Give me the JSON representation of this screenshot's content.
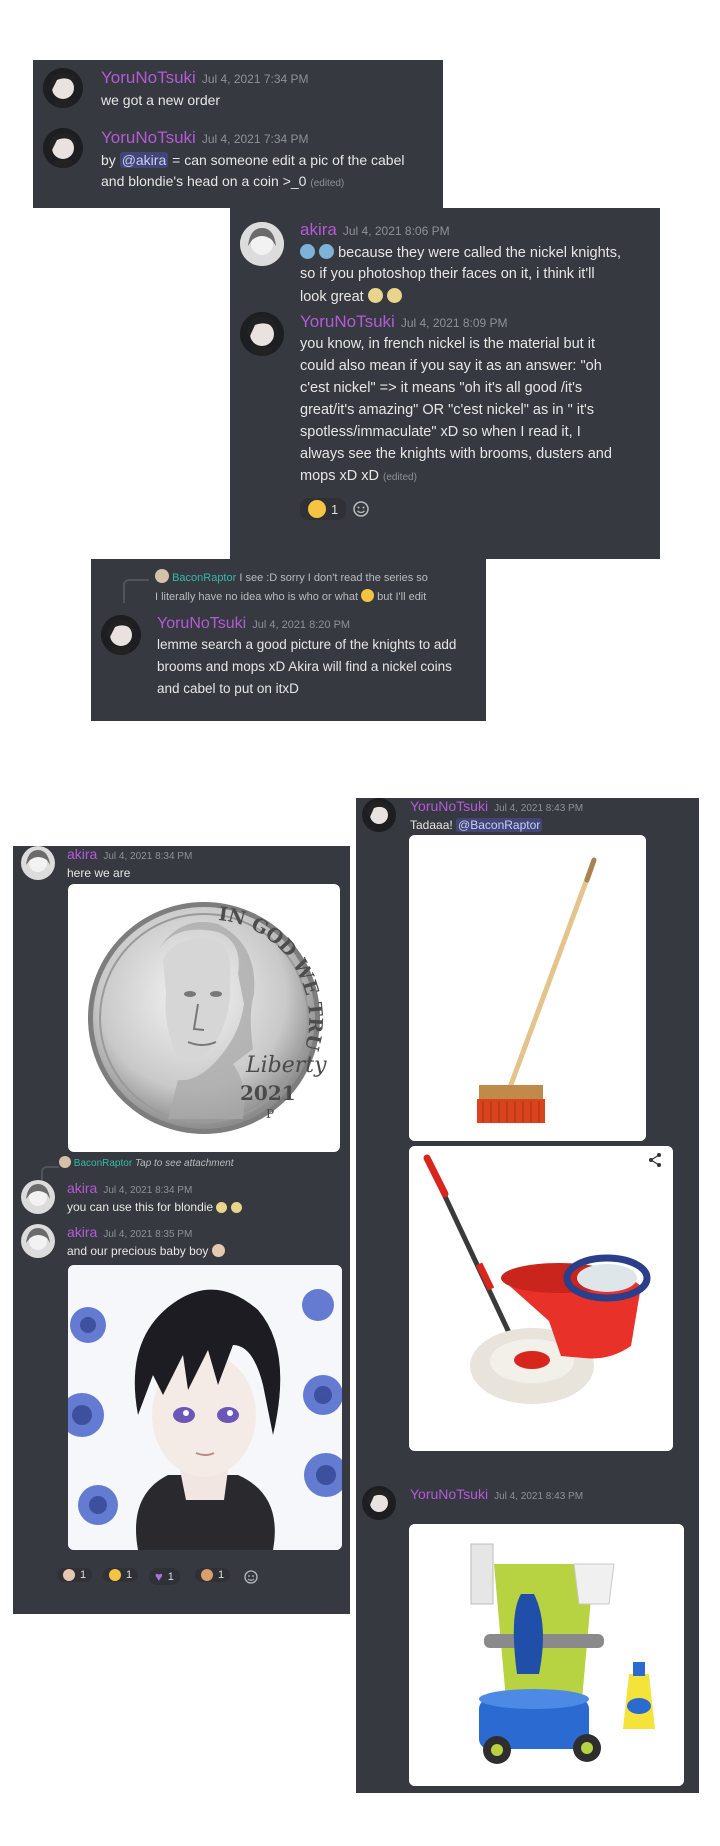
{
  "panel1": {
    "m1": {
      "author": "YoruNoTsuki",
      "time": "Jul 4, 2021 7:34 PM",
      "text": "we got a new order"
    },
    "m2": {
      "author": "YoruNoTsuki",
      "time": "Jul 4, 2021 7:34 PM",
      "pre": "by ",
      "mention": "@akira",
      "l1": " = can someone edit a pic of the cabel",
      "l2": "and blondie's head on a coin >_0",
      "edited": "(edited)"
    }
  },
  "panel2": {
    "m1": {
      "author": "akira",
      "time": "Jul 4, 2021 8:06 PM",
      "l1": "because they were called the nickel knights,",
      "l2": "so if you photoshop their faces on it, i think it'll",
      "l3": "look great"
    },
    "m2": {
      "author": "YoruNoTsuki",
      "time": "Jul 4, 2021 8:09 PM",
      "lines": [
        "you know, in french nickel is the material but it",
        "could also mean if you say it as an answer: \"oh",
        "c'est nickel\" => it means \"oh it's all good /it's",
        "great/it's amazing\" OR \"c'est nickel\" as in \" it's",
        "spotless/immaculate\" xD so when I read it, I",
        "always see the knights with brooms, dusters and"
      ],
      "last": "mops xD xD",
      "edited": "(edited)",
      "reaction_count": "1"
    }
  },
  "panel3": {
    "reply": {
      "author": "BaconRaptor",
      "l1": "I see :D sorry I don't read the series so",
      "l2a": "I literally have no idea who is who or what",
      "l2b": "but I'll edit"
    },
    "m1": {
      "author": "YoruNoTsuki",
      "time": "Jul 4, 2021 8:20 PM",
      "lines": [
        "lemme search a good picture of the knights to add",
        "brooms and mops xD Akira will find a nickel coins",
        "and cabel to put on itxD"
      ]
    }
  },
  "panel4": {
    "m1": {
      "author": "akira",
      "time": "Jul 4, 2021 8:34 PM",
      "text": "here we are"
    },
    "coin": {
      "top": "IN GOD WE TRUST",
      "sig": "Liberty",
      "year": "2021",
      "mint": "P"
    },
    "reply": {
      "author": "BaconRaptor",
      "text": "Tap to see attachment"
    },
    "m2": {
      "author": "akira",
      "time": "Jul 4, 2021 8:34 PM",
      "text": "you can use this for blondie"
    },
    "m3": {
      "author": "akira",
      "time": "Jul 4, 2021 8:35 PM",
      "text": "and our precious baby boy"
    },
    "reactions": [
      "1",
      "1",
      "1",
      "1"
    ]
  },
  "panel5": {
    "m1": {
      "author": "YoruNoTsuki",
      "time": "Jul 4, 2021 8:43 PM",
      "pre": "Tadaaa! ",
      "mention": "@BaconRaptor"
    },
    "m2": {
      "author": "YoruNoTsuki",
      "time": "Jul 4, 2021 8:43 PM"
    }
  },
  "colors": {
    "bg": "#36393f",
    "name": "#b45ad8",
    "bacon": "#36b8a7",
    "mention_bg": "#414675"
  }
}
